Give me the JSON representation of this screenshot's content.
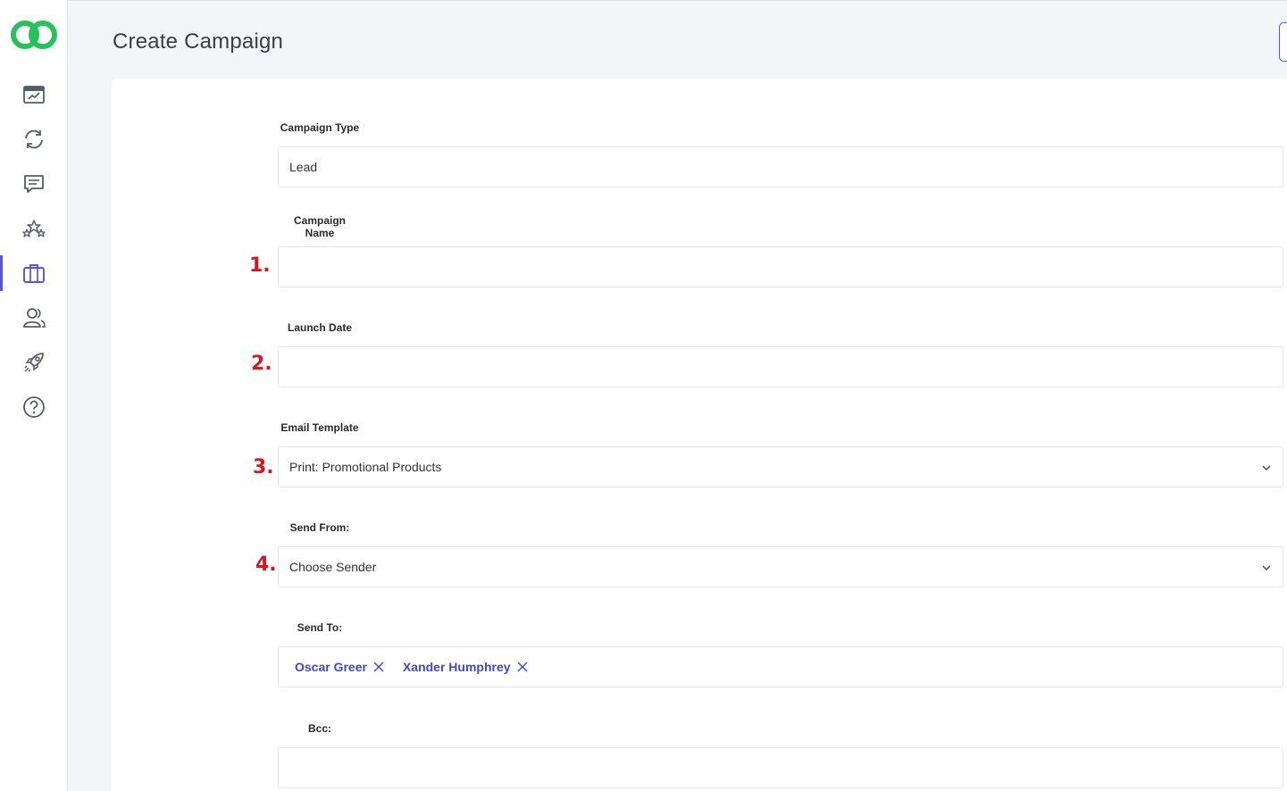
{
  "page": {
    "title": "Create Campaign"
  },
  "sidebar": {
    "items": [
      {
        "icon": "dashboard-icon"
      },
      {
        "icon": "sync-icon"
      },
      {
        "icon": "chat-icon"
      },
      {
        "icon": "stars-icon"
      },
      {
        "icon": "briefcase-icon",
        "active": true
      },
      {
        "icon": "users-icon"
      },
      {
        "icon": "rocket-icon"
      },
      {
        "icon": "help-icon"
      }
    ]
  },
  "form": {
    "campaign_type": {
      "label": "Campaign Type",
      "value": "Lead"
    },
    "campaign_name": {
      "label": "Campaign Name",
      "value": "",
      "marker": "1."
    },
    "launch_date": {
      "label": "Launch Date",
      "value": "",
      "marker": "2."
    },
    "email_template": {
      "label": "Email Template",
      "value": "Print: Promotional Products",
      "marker": "3."
    },
    "send_from": {
      "label": "Send From:",
      "value": "Choose Sender",
      "marker": "4."
    },
    "send_to": {
      "label": "Send To:",
      "recipients": [
        "Oscar Greer",
        "Xander Humphrey"
      ]
    },
    "bcc": {
      "label": "Bcc:",
      "value": ""
    }
  },
  "colors": {
    "accent": "#5b54d9",
    "marker": "#d7191f",
    "logo": "#27c35a"
  }
}
